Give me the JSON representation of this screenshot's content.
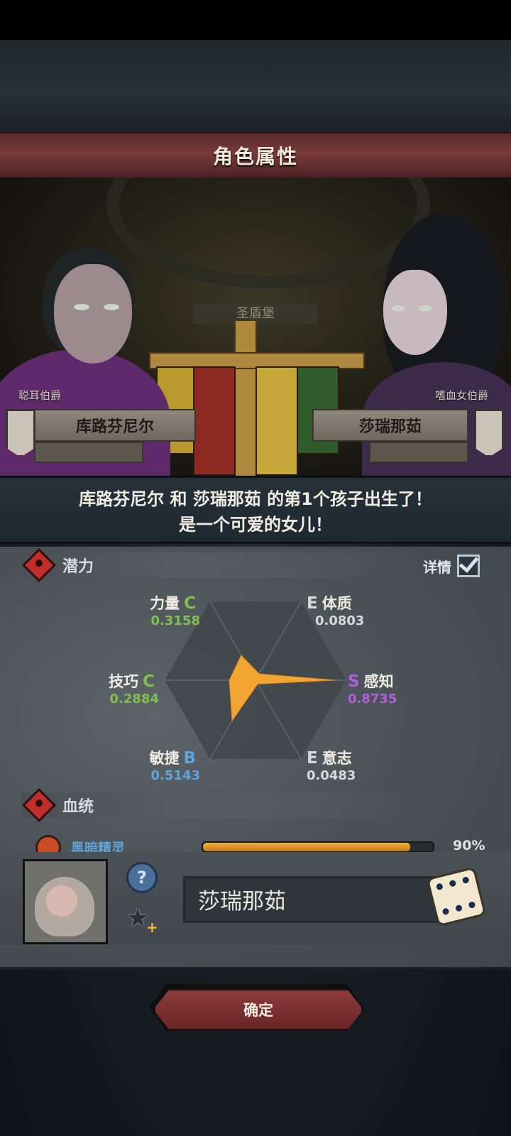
{
  "title": "角色属性",
  "scene": {
    "map_label": "圣盾堡",
    "left": {
      "title": "聪耳伯爵",
      "name": "库路芬尼尔"
    },
    "right": {
      "title": "嗜血女伯爵",
      "name": "莎瑞那茹"
    }
  },
  "announcement": {
    "line1": "库路芬尼尔 和 莎瑞那茹 的第1个孩子出生了！",
    "line2": "是一个可爱的女儿！"
  },
  "potential": {
    "heading": "潜力",
    "detail_label": "详情",
    "detail_checked": true,
    "stats": [
      {
        "key": "strength",
        "label": "力量",
        "grade": "C",
        "value": "0.3158",
        "color": "#7ec04e"
      },
      {
        "key": "constitution",
        "label": "体质",
        "grade": "E",
        "value": "0.0803",
        "color": "#d6d8da"
      },
      {
        "key": "perception",
        "label": "感知",
        "grade": "S",
        "value": "0.8735",
        "color": "#b25ce0"
      },
      {
        "key": "will",
        "label": "意志",
        "grade": "E",
        "value": "0.0483",
        "color": "#d6d8da"
      },
      {
        "key": "agility",
        "label": "敏捷",
        "grade": "B",
        "value": "0.5143",
        "color": "#5ea4dd"
      },
      {
        "key": "skill",
        "label": "技巧",
        "grade": "C",
        "value": "0.2884",
        "color": "#7ec04e"
      }
    ]
  },
  "bloodline": {
    "heading": "血统",
    "name": "黑暗精灵",
    "percent_label": "90%",
    "percent": 0.9
  },
  "child": {
    "name": "莎瑞那茹"
  },
  "confirm_label": "确定",
  "colors": {
    "accent": "#f2a532",
    "banner": "#7a3a3b"
  }
}
